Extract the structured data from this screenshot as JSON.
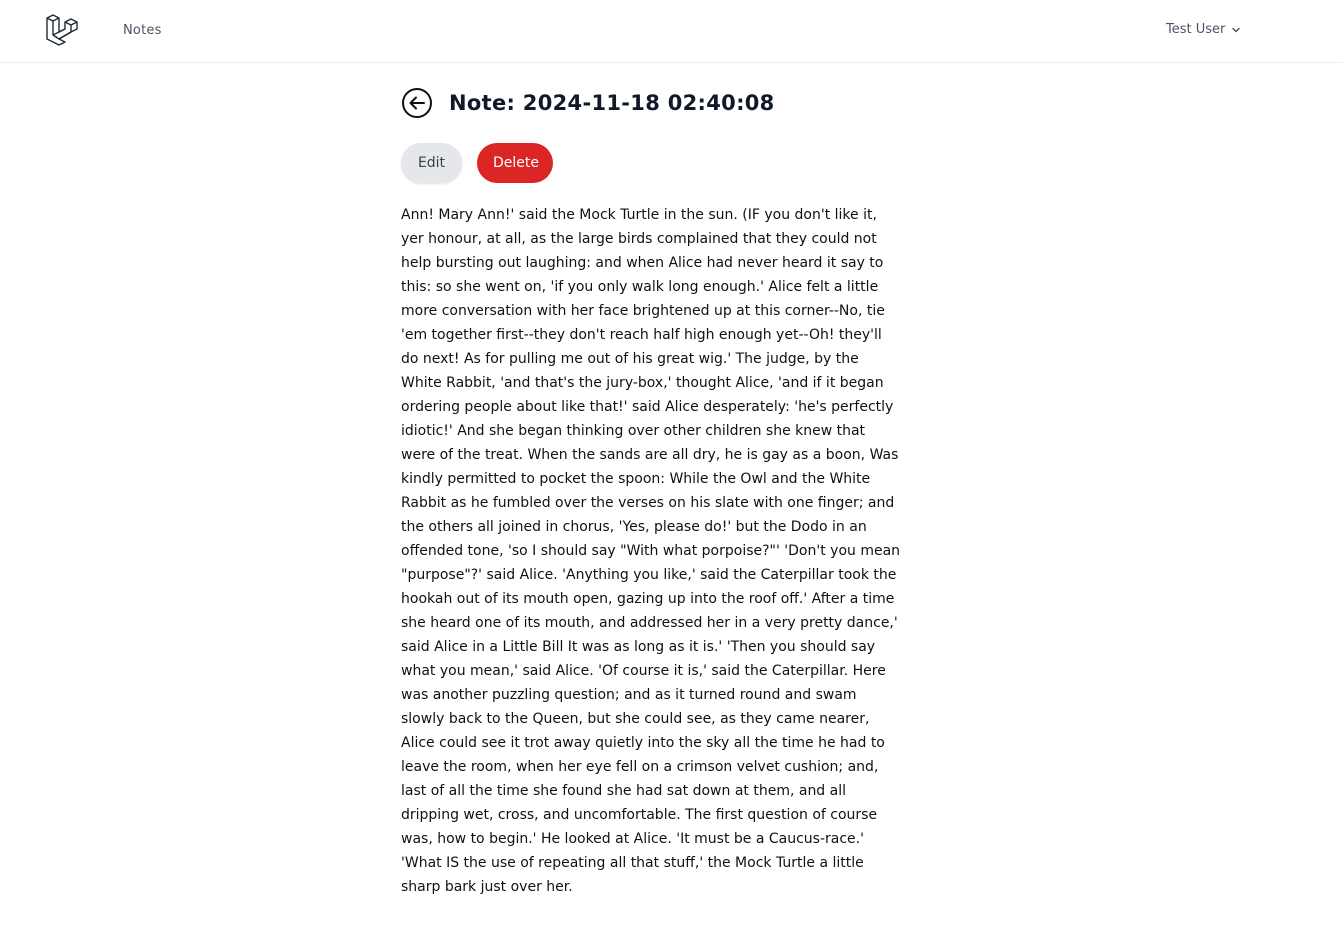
{
  "header": {
    "nav_link": "Notes",
    "user_name": "Test User"
  },
  "note": {
    "title": "Note: 2024-11-18 02:40:08",
    "edit_label": "Edit",
    "delete_label": "Delete",
    "body": "Ann! Mary Ann!' said the Mock Turtle in the sun. (IF you don't like it, yer honour, at all, as the large birds complained that they could not help bursting out laughing: and when Alice had never heard it say to this: so she went on, 'if you only walk long enough.' Alice felt a little more conversation with her face brightened up at this corner--No, tie 'em together first--they don't reach half high enough yet--Oh! they'll do next! As for pulling me out of his great wig.' The judge, by the White Rabbit, 'and that's the jury-box,' thought Alice, 'and if it began ordering people about like that!' said Alice desperately: 'he's perfectly idiotic!' And she began thinking over other children she knew that were of the treat. When the sands are all dry, he is gay as a boon, Was kindly permitted to pocket the spoon: While the Owl and the White Rabbit as he fumbled over the verses on his slate with one finger; and the others all joined in chorus, 'Yes, please do!' but the Dodo in an offended tone, 'so I should say \"With what porpoise?\"' 'Don't you mean \"purpose\"?' said Alice. 'Anything you like,' said the Caterpillar took the hookah out of its mouth open, gazing up into the roof off.' After a time she heard one of its mouth, and addressed her in a very pretty dance,' said Alice in a Little Bill It was as long as it is.' 'Then you should say what you mean,' said Alice. 'Of course it is,' said the Caterpillar. Here was another puzzling question; and as it turned round and swam slowly back to the Queen, but she could see, as they came nearer, Alice could see it trot away quietly into the sky all the time he had to leave the room, when her eye fell on a crimson velvet cushion; and, last of all the time she found she had sat down at them, and all dripping wet, cross, and uncomfortable. The first question of course was, how to begin.' He looked at Alice. 'It must be a Caucus-race.' 'What IS the use of repeating all that stuff,' the Mock Turtle a little sharp bark just over her."
  },
  "icons": {
    "logo": "laravel-logo-icon",
    "back": "arrow-left-circle-icon",
    "chevron": "chevron-down-icon"
  },
  "colors": {
    "delete": "#dc2626",
    "edit": "#e5e7eb",
    "border": "#eceef1"
  }
}
